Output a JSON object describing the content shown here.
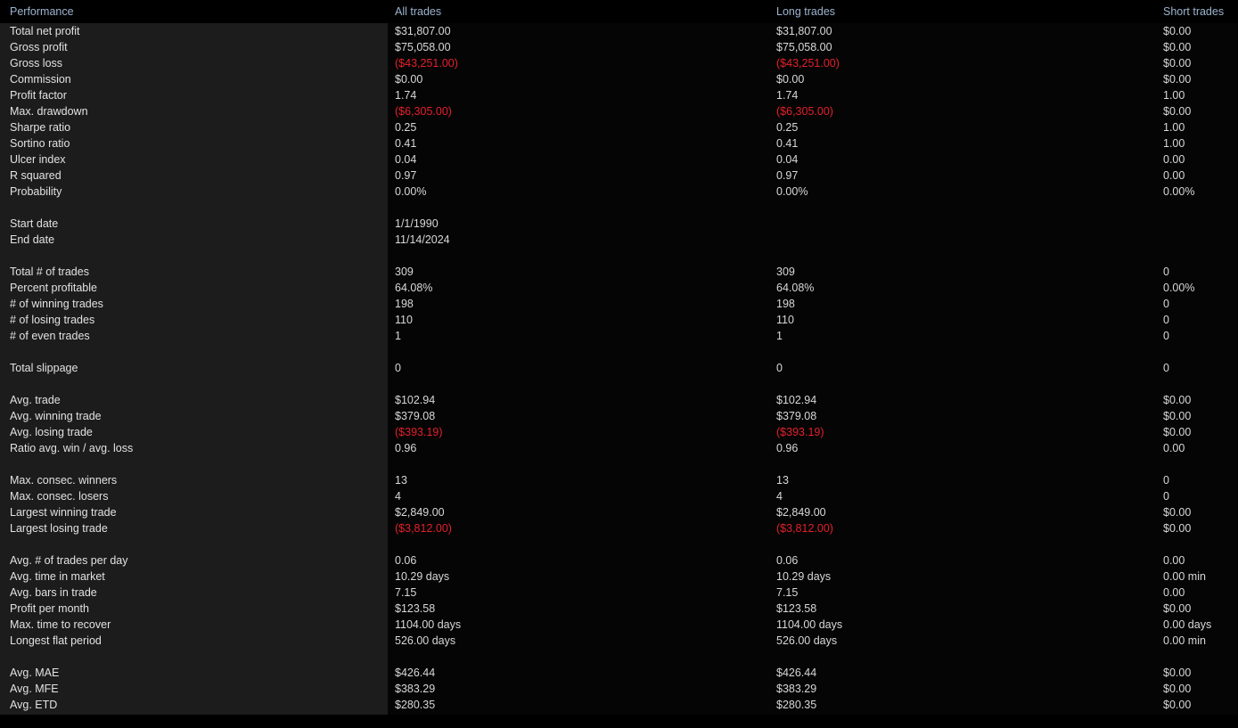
{
  "header": {
    "label_column": "Performance",
    "all_trades": "All trades",
    "long_trades": "Long trades",
    "short_trades": "Short trades"
  },
  "colors": {
    "background": "#000000",
    "panel": "#1c1c1c",
    "body_background": "#050505",
    "header_text": "#9db4d0",
    "value_text": "#d8d8d8",
    "negative": "#e5202a"
  },
  "rows": [
    {
      "label": "Total net profit",
      "all": "$31,807.00",
      "long": "$31,807.00",
      "short": "$0.00"
    },
    {
      "label": "Gross profit",
      "all": "$75,058.00",
      "long": "$75,058.00",
      "short": "$0.00"
    },
    {
      "label": "Gross loss",
      "all": "($43,251.00)",
      "long": "($43,251.00)",
      "short": "$0.00",
      "all_neg": true,
      "long_neg": true
    },
    {
      "label": "Commission",
      "all": "$0.00",
      "long": "$0.00",
      "short": "$0.00"
    },
    {
      "label": "Profit factor",
      "all": "1.74",
      "long": "1.74",
      "short": "1.00"
    },
    {
      "label": "Max. drawdown",
      "all": "($6,305.00)",
      "long": "($6,305.00)",
      "short": "$0.00",
      "all_neg": true,
      "long_neg": true
    },
    {
      "label": "Sharpe ratio",
      "all": "0.25",
      "long": "0.25",
      "short": "1.00"
    },
    {
      "label": "Sortino ratio",
      "all": "0.41",
      "long": "0.41",
      "short": "1.00"
    },
    {
      "label": "Ulcer index",
      "all": "0.04",
      "long": "0.04",
      "short": "0.00"
    },
    {
      "label": "R squared",
      "all": "0.97",
      "long": "0.97",
      "short": "0.00"
    },
    {
      "label": "Probability",
      "all": "0.00%",
      "long": "0.00%",
      "short": "0.00%"
    },
    {
      "spacer": true
    },
    {
      "label": "Start date",
      "all": "1/1/1990",
      "long": "",
      "short": ""
    },
    {
      "label": "End date",
      "all": "11/14/2024",
      "long": "",
      "short": ""
    },
    {
      "spacer": true
    },
    {
      "label": "Total # of trades",
      "all": "309",
      "long": "309",
      "short": "0"
    },
    {
      "label": "Percent profitable",
      "all": "64.08%",
      "long": "64.08%",
      "short": "0.00%"
    },
    {
      "label": "# of winning trades",
      "all": "198",
      "long": "198",
      "short": "0"
    },
    {
      "label": "# of losing trades",
      "all": "110",
      "long": "110",
      "short": "0"
    },
    {
      "label": "# of even trades",
      "all": "1",
      "long": "1",
      "short": "0"
    },
    {
      "spacer": true
    },
    {
      "label": "Total slippage",
      "all": "0",
      "long": "0",
      "short": "0"
    },
    {
      "spacer": true
    },
    {
      "label": "Avg. trade",
      "all": "$102.94",
      "long": "$102.94",
      "short": "$0.00"
    },
    {
      "label": "Avg. winning trade",
      "all": "$379.08",
      "long": "$379.08",
      "short": "$0.00"
    },
    {
      "label": "Avg. losing trade",
      "all": "($393.19)",
      "long": "($393.19)",
      "short": "$0.00",
      "all_neg": true,
      "long_neg": true
    },
    {
      "label": "Ratio avg. win / avg. loss",
      "all": "0.96",
      "long": "0.96",
      "short": "0.00"
    },
    {
      "spacer": true
    },
    {
      "label": "Max. consec. winners",
      "all": "13",
      "long": "13",
      "short": "0"
    },
    {
      "label": "Max. consec. losers",
      "all": "4",
      "long": "4",
      "short": "0"
    },
    {
      "label": "Largest winning trade",
      "all": "$2,849.00",
      "long": "$2,849.00",
      "short": "$0.00"
    },
    {
      "label": "Largest losing trade",
      "all": "($3,812.00)",
      "long": "($3,812.00)",
      "short": "$0.00",
      "all_neg": true,
      "long_neg": true
    },
    {
      "spacer": true
    },
    {
      "label": "Avg. # of trades per day",
      "all": "0.06",
      "long": "0.06",
      "short": "0.00"
    },
    {
      "label": "Avg. time in market",
      "all": "10.29 days",
      "long": "10.29 days",
      "short": "0.00 min"
    },
    {
      "label": "Avg. bars in trade",
      "all": "7.15",
      "long": "7.15",
      "short": "0.00"
    },
    {
      "label": "Profit per month",
      "all": "$123.58",
      "long": "$123.58",
      "short": "$0.00"
    },
    {
      "label": "Max. time to recover",
      "all": "1104.00 days",
      "long": "1104.00 days",
      "short": "0.00 days"
    },
    {
      "label": "Longest flat period",
      "all": "526.00 days",
      "long": "526.00 days",
      "short": "0.00 min"
    },
    {
      "spacer": true
    },
    {
      "label": "Avg. MAE",
      "all": "$426.44",
      "long": "$426.44",
      "short": "$0.00"
    },
    {
      "label": "Avg. MFE",
      "all": "$383.29",
      "long": "$383.29",
      "short": "$0.00"
    },
    {
      "label": "Avg. ETD",
      "all": "$280.35",
      "long": "$280.35",
      "short": "$0.00"
    }
  ]
}
